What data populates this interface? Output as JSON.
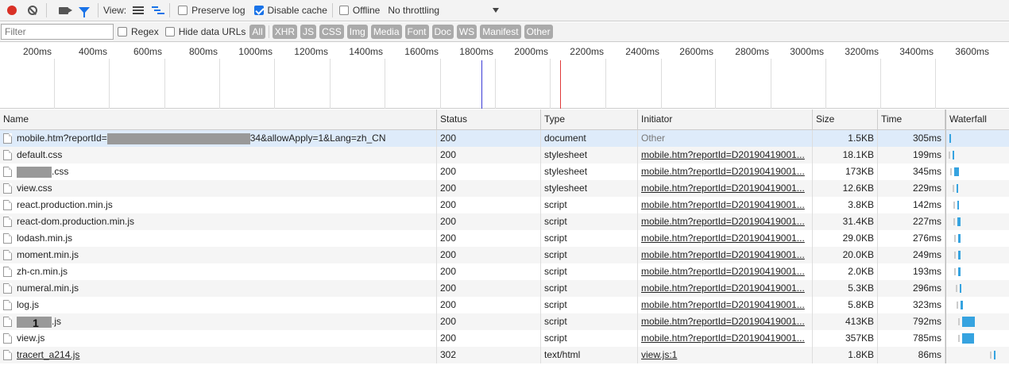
{
  "toolbar": {
    "view_label": "View:",
    "preserve_log_label": "Preserve log",
    "preserve_log_checked": false,
    "disable_cache_label": "Disable cache",
    "disable_cache_checked": true,
    "offline_label": "Offline",
    "offline_checked": false,
    "throttling_value": "No throttling",
    "accent_color": "#1a73e8",
    "record_color": "#d93025"
  },
  "filterbar": {
    "filter_placeholder": "Filter",
    "regex_label": "Regex",
    "hide_data_urls_label": "Hide data URLs",
    "types": [
      "All",
      "XHR",
      "JS",
      "CSS",
      "Img",
      "Media",
      "Font",
      "Doc",
      "WS",
      "Manifest",
      "Other"
    ]
  },
  "overview": {
    "ticks": [
      "200ms",
      "400ms",
      "600ms",
      "800ms",
      "1000ms",
      "1200ms",
      "1400ms",
      "1600ms",
      "1800ms",
      "2000ms",
      "2200ms",
      "2400ms",
      "2600ms",
      "2800ms",
      "3000ms",
      "3200ms",
      "3400ms",
      "3600ms"
    ],
    "dom_content_loaded_color": "#3b3bd6",
    "load_color": "#e03a3a"
  },
  "columns": {
    "name": "Name",
    "status": "Status",
    "type": "Type",
    "initiator": "Initiator",
    "size": "Size",
    "time": "Time",
    "waterfall": "Waterfall"
  },
  "rows": [
    {
      "name_pre": "mobile.htm?reportId=",
      "name_post": "34&allowApply=1&Lang=zh_CN",
      "status": "200",
      "type": "document",
      "initiator": "Other",
      "size": "1.5KB",
      "time": "305ms"
    },
    {
      "name_pre": "default.css",
      "name_post": "",
      "status": "200",
      "type": "stylesheet",
      "initiator": "mobile.htm?reportId=D20190419001...",
      "size": "18.1KB",
      "time": "199ms"
    },
    {
      "name_pre": "",
      "name_post": ".css",
      "status": "200",
      "type": "stylesheet",
      "initiator": "mobile.htm?reportId=D20190419001...",
      "size": "173KB",
      "time": "345ms"
    },
    {
      "name_pre": "view.css",
      "name_post": "",
      "status": "200",
      "type": "stylesheet",
      "initiator": "mobile.htm?reportId=D20190419001...",
      "size": "12.6KB",
      "time": "229ms"
    },
    {
      "name_pre": "react.production.min.js",
      "name_post": "",
      "status": "200",
      "type": "script",
      "initiator": "mobile.htm?reportId=D20190419001...",
      "size": "3.8KB",
      "time": "142ms"
    },
    {
      "name_pre": "react-dom.production.min.js",
      "name_post": "",
      "status": "200",
      "type": "script",
      "initiator": "mobile.htm?reportId=D20190419001...",
      "size": "31.4KB",
      "time": "227ms"
    },
    {
      "name_pre": "lodash.min.js",
      "name_post": "",
      "status": "200",
      "type": "script",
      "initiator": "mobile.htm?reportId=D20190419001...",
      "size": "29.0KB",
      "time": "276ms"
    },
    {
      "name_pre": "moment.min.js",
      "name_post": "",
      "status": "200",
      "type": "script",
      "initiator": "mobile.htm?reportId=D20190419001...",
      "size": "20.0KB",
      "time": "249ms"
    },
    {
      "name_pre": "zh-cn.min.js",
      "name_post": "",
      "status": "200",
      "type": "script",
      "initiator": "mobile.htm?reportId=D20190419001...",
      "size": "2.0KB",
      "time": "193ms"
    },
    {
      "name_pre": "numeral.min.js",
      "name_post": "",
      "status": "200",
      "type": "script",
      "initiator": "mobile.htm?reportId=D20190419001...",
      "size": "5.3KB",
      "time": "296ms"
    },
    {
      "name_pre": "log.js",
      "name_post": "",
      "status": "200",
      "type": "script",
      "initiator": "mobile.htm?reportId=D20190419001...",
      "size": "5.8KB",
      "time": "323ms"
    },
    {
      "name_pre": "",
      "name_post": ".js",
      "redact_text": "1",
      "status": "200",
      "type": "script",
      "initiator": "mobile.htm?reportId=D20190419001...",
      "size": "413KB",
      "time": "792ms"
    },
    {
      "name_pre": "view.js",
      "name_post": "",
      "status": "200",
      "type": "script",
      "initiator": "mobile.htm?reportId=D20190419001...",
      "size": "357KB",
      "time": "785ms"
    },
    {
      "name_pre": "tracert_a214.js",
      "name_post": "",
      "status": "302",
      "type": "text/html",
      "initiator": "view.js:1",
      "size": "1.8KB",
      "time": "86ms"
    }
  ]
}
